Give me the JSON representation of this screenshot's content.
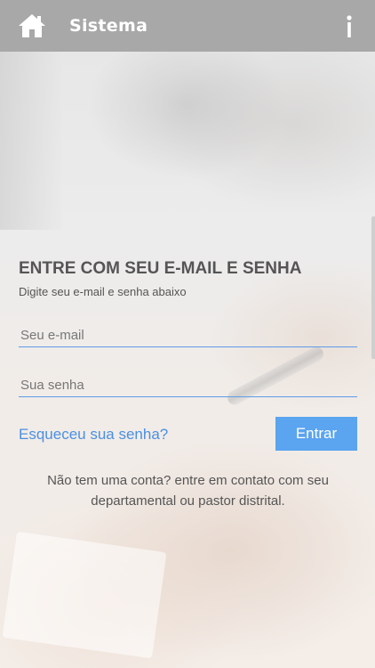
{
  "header": {
    "title": "Sistema",
    "home_icon": "home-icon",
    "info_icon": "info-icon",
    "background_color": "#a8a8a8"
  },
  "login": {
    "title": "ENTRE COM SEU E-MAIL E SENHA",
    "subtitle": "Digite seu e-mail e senha abaixo",
    "email_placeholder": "Seu e-mail",
    "email_value": "",
    "password_placeholder": "Sua senha",
    "password_value": "",
    "forgot_label": "Esqueceu sua senha?",
    "submit_label": "Entrar",
    "note_line1": "Não tem uma conta? entre em contato com seu",
    "note_line2": "departamental ou pastor distrital."
  },
  "colors": {
    "accent": "#5aa4f0",
    "link": "#4a90e2",
    "text": "#555555"
  }
}
